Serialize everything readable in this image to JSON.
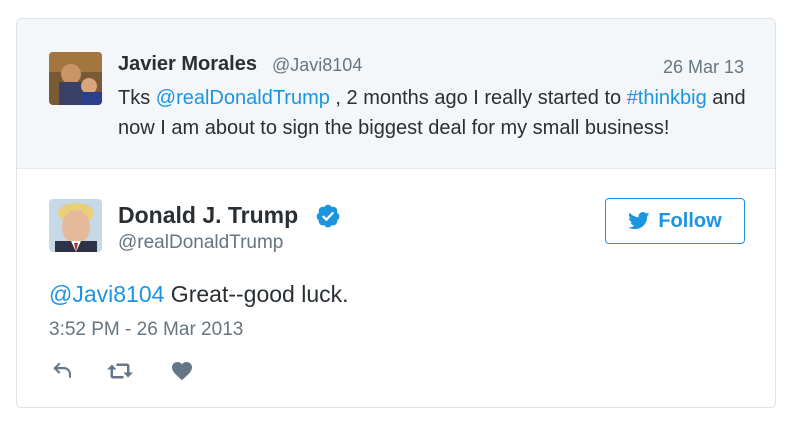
{
  "quoted_tweet": {
    "author_name": "Javier Morales",
    "author_handle": "@Javi8104",
    "date": "26 Mar 13",
    "text_parts": [
      {
        "text": "Tks ",
        "link": false
      },
      {
        "text": "@realDonaldTrump",
        "link": true
      },
      {
        "text": " , 2 months ago I really started to ",
        "link": false
      },
      {
        "text": "#thinkbig",
        "link": true
      },
      {
        "text": " and now I am about to sign the biggest deal for my small business!",
        "link": false
      }
    ]
  },
  "tweet": {
    "author_name": "Donald J. Trump",
    "author_handle": "@realDonaldTrump",
    "verified": true,
    "follow_label": "Follow",
    "mention": "@Javi8104",
    "body": " Great--good luck.",
    "timestamp": "3:52 PM - 26 Mar 2013"
  },
  "colors": {
    "link": "#1b95e0",
    "text": "#292f33",
    "muted": "#66757f",
    "action_icon": "#657786"
  },
  "icons": [
    "reply-icon",
    "retweet-icon",
    "like-icon",
    "twitter-bird-icon",
    "verified-badge-icon"
  ]
}
